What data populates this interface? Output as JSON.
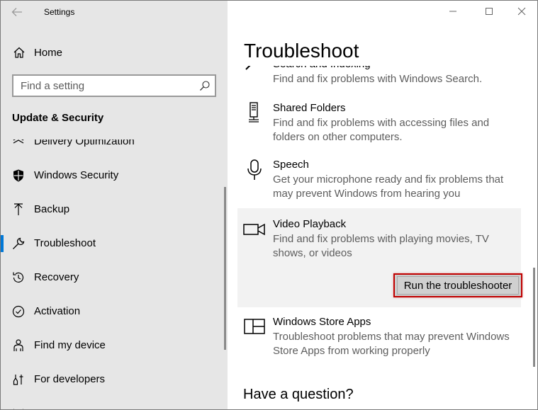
{
  "window": {
    "app_title": "Settings",
    "controls": [
      "minimize",
      "maximize",
      "close"
    ]
  },
  "sidebar": {
    "home_label": "Home",
    "search_placeholder": "Find a setting",
    "section_title": "Update & Security",
    "items": [
      {
        "label": "Delivery Optimization",
        "icon": "delivery-optimization-icon",
        "active": false
      },
      {
        "label": "Windows Security",
        "icon": "shield-icon",
        "active": false
      },
      {
        "label": "Backup",
        "icon": "backup-arrow-icon",
        "active": false
      },
      {
        "label": "Troubleshoot",
        "icon": "wrench-icon",
        "active": true
      },
      {
        "label": "Recovery",
        "icon": "recovery-history-icon",
        "active": false
      },
      {
        "label": "Activation",
        "icon": "check-circle-icon",
        "active": false
      },
      {
        "label": "Find my device",
        "icon": "person-location-icon",
        "active": false
      },
      {
        "label": "For developers",
        "icon": "developer-tools-icon",
        "active": false
      },
      {
        "label": "",
        "icon": "windows-insider-icon",
        "active": false
      }
    ]
  },
  "main": {
    "page_title": "Troubleshoot",
    "items": [
      {
        "name": "Search and Indexing",
        "description": "Find and fix problems with Windows Search.",
        "icon": "search-icon"
      },
      {
        "name": "Shared Folders",
        "description": "Find and fix problems with accessing files and folders on other computers.",
        "icon": "shared-folders-icon"
      },
      {
        "name": "Speech",
        "description": "Get your microphone ready and fix problems that may prevent Windows from hearing you",
        "icon": "microphone-icon"
      },
      {
        "name": "Video Playback",
        "description": "Find and fix problems with playing movies, TV shows, or videos",
        "icon": "video-camera-icon",
        "selected": true,
        "button_label": "Run the troubleshooter"
      },
      {
        "name": "Windows Store Apps",
        "description": "Troubleshoot problems that may prevent Windows Store Apps from working properly",
        "icon": "store-apps-icon"
      }
    ],
    "have_question": "Have a question?"
  },
  "colors": {
    "accent": "#0078d7",
    "sidebar_bg": "#e6e6e6",
    "highlight_border": "#c00000"
  }
}
